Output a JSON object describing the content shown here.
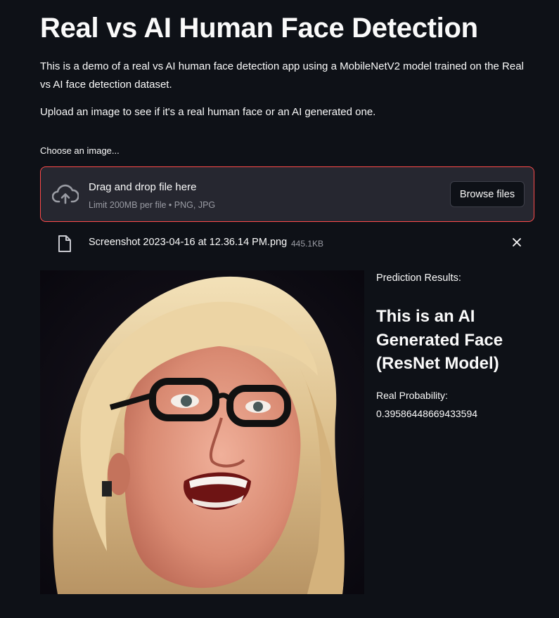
{
  "app": {
    "title": "Real vs AI Human Face Detection",
    "description": "This is a demo of a real vs AI human face detection app using a MobileNetV2 model trained on the Real vs AI face detection dataset.",
    "instruction": "Upload an image to see if it's a real human face or an AI generated one."
  },
  "uploader": {
    "label": "Choose an image...",
    "drop_text": "Drag and drop file here",
    "limit_text": "Limit 200MB per file • PNG, JPG",
    "browse_label": "Browse files",
    "icon": "cloud-upload-icon",
    "border_color": "#ff4b4b"
  },
  "uploaded_file": {
    "name": "Screenshot 2023-04-16 at 12.36.14 PM.png",
    "size": "445.1KB",
    "icon": "file-icon",
    "remove_icon": "close-icon"
  },
  "results": {
    "label": "Prediction Results:",
    "heading": "This is an AI Generated Face (ResNet Model)",
    "probability_label": "Real Probability:",
    "probability_value": "0.39586448669433594"
  },
  "theme": {
    "background": "#0e1117",
    "panel": "#262730",
    "text": "#fafafa",
    "muted": "#9a9ca4",
    "accent": "#ff4b4b"
  }
}
